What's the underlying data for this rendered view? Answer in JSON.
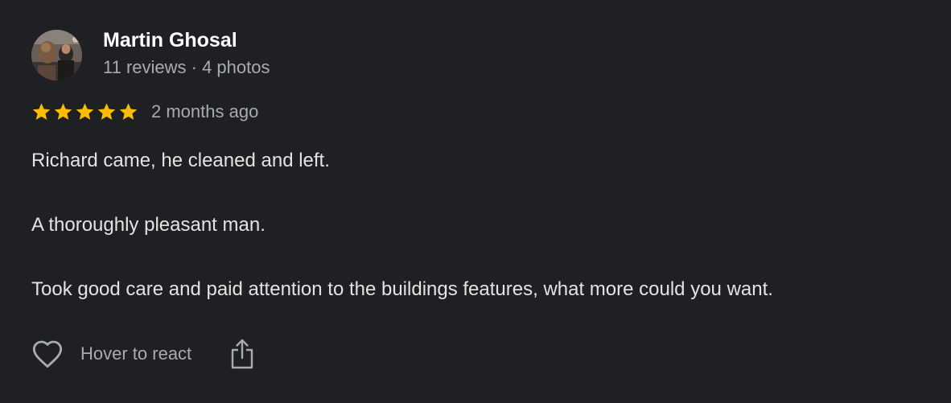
{
  "review": {
    "author": {
      "name": "Martin Ghosal",
      "meta": "11 reviews · 4 photos"
    },
    "rating": 5,
    "rating_max": 5,
    "date": "2 months ago",
    "paragraphs": [
      "Richard came, he cleaned and left.",
      "A thoroughly pleasant man.",
      "Took good care and paid attention to the buildings features, what more could you want."
    ],
    "actions": {
      "react_label": "Hover to react",
      "react_icon": "heart-outline-icon",
      "share_icon": "share-icon"
    }
  },
  "colors": {
    "background": "#1f2024",
    "star": "#fbbc04",
    "name": "#ffffff",
    "secondary_text": "#a8abb0",
    "body_text": "#e3e3e3"
  }
}
